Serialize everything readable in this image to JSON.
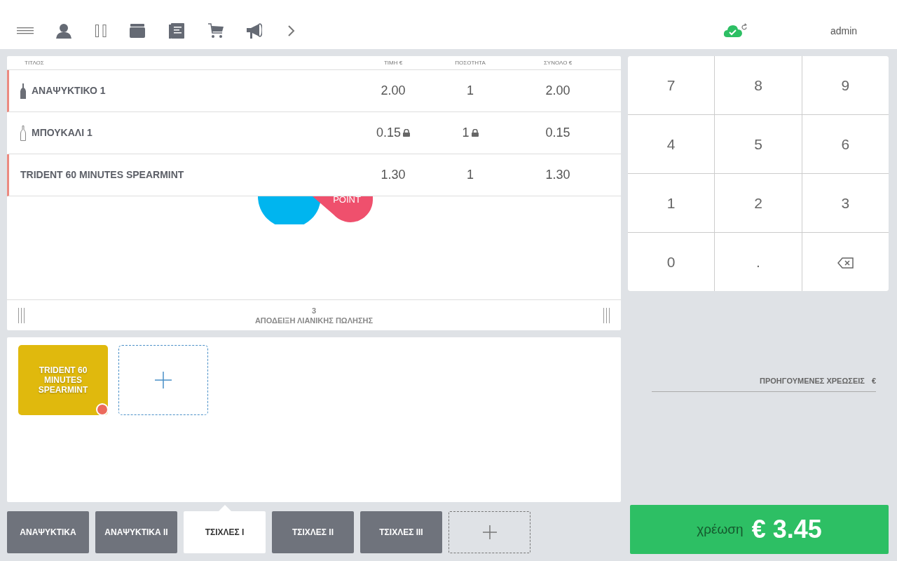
{
  "topbar": {
    "user": "admin"
  },
  "receipt": {
    "columns": [
      "ΤΙΤΛΟΣ",
      "ΤΙΜΗ €",
      "ΠΟΣΟΤΗΤΑ",
      "ΣΥΝΟΛΟ €"
    ],
    "rows": [
      {
        "kind": "bottle-filled",
        "marked": true,
        "title": "ΑΝΑΨΥΚΤΙΚΟ 1",
        "price": "2.00",
        "price_locked": false,
        "qty": "1",
        "qty_locked": false,
        "total": "2.00"
      },
      {
        "kind": "bottle-outline",
        "marked": false,
        "title": "ΜΠΟΥΚΑΛΙ 1",
        "price": "0.15",
        "price_locked": true,
        "qty": "1",
        "qty_locked": true,
        "total": "0.15"
      },
      {
        "kind": "plain",
        "marked": true,
        "title": "TRIDENT 60 MINUTES SPEARMINT",
        "price": "1.30",
        "price_locked": false,
        "qty": "1",
        "qty_locked": false,
        "total": "1.30"
      }
    ],
    "logo_text": "POINT",
    "count": "3",
    "document_type": "ΑΠΟΔΕΙΞΗ ΛΙΑΝΙΚΗΣ ΠΩΛΗΣΗΣ"
  },
  "products": [
    {
      "label": "TRIDENT 60 MINUTES SPEARMINT",
      "color": "#e0b90d",
      "dot": true
    }
  ],
  "categories": [
    {
      "label": "ΑΝΑΨΥΚΤΙΚΑ",
      "selected": false
    },
    {
      "label": "ΑΝΑΨΥΚΤΙΚΑ II",
      "selected": false
    },
    {
      "label": "ΤΣΙΧΛΕΣ I",
      "selected": true
    },
    {
      "label": "ΤΣΙΧΛΕΣ II",
      "selected": false
    },
    {
      "label": "ΤΣΙΧΛΕΣ III",
      "selected": false
    }
  ],
  "keypad": [
    {
      "kind": "key",
      "label": "7"
    },
    {
      "kind": "key",
      "label": "8"
    },
    {
      "kind": "key",
      "label": "9"
    },
    {
      "kind": "key",
      "label": "4"
    },
    {
      "kind": "key",
      "label": "5"
    },
    {
      "kind": "key",
      "label": "6"
    },
    {
      "kind": "key",
      "label": "1"
    },
    {
      "kind": "key",
      "label": "2"
    },
    {
      "kind": "key",
      "label": "3"
    },
    {
      "kind": "key",
      "label": "0"
    },
    {
      "kind": "key",
      "label": "."
    },
    {
      "kind": "backspace"
    }
  ],
  "previous_charges": {
    "label": "ΠΡΟΗΓΟΥΜΕΝΕΣ ΧΡΕΩΣΕΙΣ",
    "currency": "€"
  },
  "charge": {
    "label": "χρέωση",
    "amount": "€ 3.45"
  }
}
